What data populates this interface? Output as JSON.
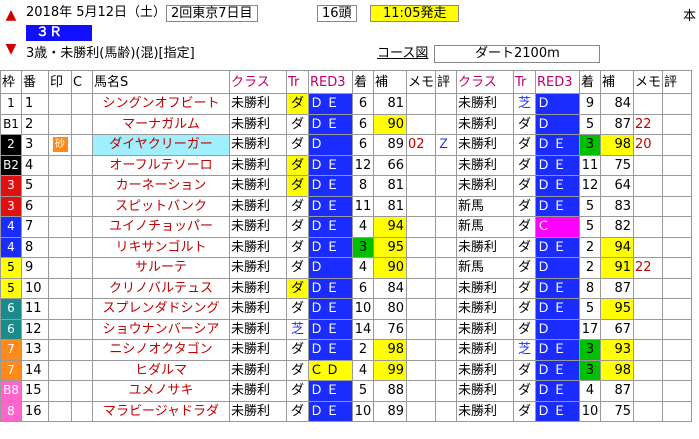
{
  "header": {
    "date": "2018年 5月12日（土）",
    "meeting": "2回東京7日目",
    "headcount": "16頭",
    "post_time": "11:05発走",
    "race_no": "３Ｒ",
    "conditions": "3歳・未勝利(馬齢)(混)[指定]",
    "course_label": "コース図",
    "course": "ダート2100m",
    "corner_text": "本"
  },
  "columns": {
    "waku": "枠",
    "ban": "番",
    "mark": "印",
    "c": "C",
    "name": "馬名S",
    "class": "クラス",
    "tr": "Tr",
    "rep": "RED3",
    "chaku": "着",
    "ho": "補",
    "memo": "メモ",
    "hyo": "評",
    "class2": "クラス",
    "tr2": "Tr",
    "rep2": "RED3",
    "chaku2": "着",
    "ho2": "補",
    "memo2": "メモ",
    "hyo2": "評"
  },
  "rows": [
    {
      "waku": "1",
      "wk": "w1",
      "ban": "1",
      "mark": "",
      "c": "",
      "name": "シングンオフビート",
      "cls": "未勝利",
      "tr": "ダ",
      "trc": "ylw",
      "r1": "Ｄ",
      "r2": "Ｅ",
      "rc": "blue",
      "ch": "6",
      "ho": "81",
      "hoc": "",
      "memo": "",
      "hyo": "",
      "cls2": "未勝利",
      "tr2": "芝",
      "tr2c": "trsh",
      "r21": "Ｄ",
      "r22": "",
      "r2c": "blue",
      "ch2": "9",
      "ch2c": "",
      "ho2": "84",
      "ho2c": "",
      "memo2": "",
      "hyo2": ""
    },
    {
      "waku": "B1",
      "wk": "w1",
      "ban": "2",
      "mark": "",
      "c": "",
      "name": "マーナガルム",
      "cls": "未勝利",
      "tr": "ダ",
      "trc": "",
      "r1": "Ｄ",
      "r2": "Ｅ",
      "rc": "blue",
      "ch": "6",
      "ho": "90",
      "hoc": "ylw",
      "memo": "",
      "hyo": "",
      "cls2": "未勝利",
      "tr2": "ダ",
      "tr2c": "",
      "r21": "Ｄ",
      "r22": "",
      "r2c": "blue",
      "ch2": "5",
      "ch2c": "",
      "ho2": "87",
      "ho2c": "",
      "memo2": "22",
      "hyo2": ""
    },
    {
      "waku": "2",
      "wk": "w2",
      "ban": "3",
      "mark": "砂",
      "c": "",
      "name": "ダイヤクリーガー",
      "cls": "未勝利",
      "tr": "ダ",
      "trc": "",
      "r1": "Ｄ",
      "r2": "",
      "rc": "blue",
      "ch": "6",
      "ho": "89",
      "hoc": "",
      "memo": "02",
      "hyo": "Ｚ",
      "cls2": "未勝利",
      "tr2": "ダ",
      "tr2c": "",
      "r21": "Ｄ",
      "r22": "Ｅ",
      "r2c": "blue",
      "ch2": "3",
      "ch2c": "grn",
      "ho2": "98",
      "ho2c": "ylw",
      "memo2": "20",
      "hyo2": ""
    },
    {
      "waku": "B2",
      "wk": "w2",
      "ban": "4",
      "mark": "",
      "c": "",
      "name": "オーフルテソーロ",
      "cls": "未勝利",
      "tr": "ダ",
      "trc": "ylw",
      "r1": "Ｄ",
      "r2": "Ｅ",
      "rc": "blue",
      "ch": "12",
      "ho": "66",
      "hoc": "",
      "memo": "",
      "hyo": "",
      "cls2": "未勝利",
      "tr2": "ダ",
      "tr2c": "",
      "r21": "Ｄ",
      "r22": "Ｅ",
      "r2c": "blue",
      "ch2": "11",
      "ch2c": "",
      "ho2": "75",
      "ho2c": "",
      "memo2": "",
      "hyo2": ""
    },
    {
      "waku": "3",
      "wk": "w3",
      "ban": "5",
      "mark": "",
      "c": "",
      "name": "カーネーション",
      "cls": "未勝利",
      "tr": "ダ",
      "trc": "ylw",
      "r1": "Ｄ",
      "r2": "Ｅ",
      "rc": "blue",
      "ch": "8",
      "ho": "81",
      "hoc": "",
      "memo": "",
      "hyo": "",
      "cls2": "未勝利",
      "tr2": "ダ",
      "tr2c": "",
      "r21": "Ｄ",
      "r22": "Ｅ",
      "r2c": "blue",
      "ch2": "12",
      "ch2c": "",
      "ho2": "64",
      "ho2c": "",
      "memo2": "",
      "hyo2": ""
    },
    {
      "waku": "3",
      "wk": "w3",
      "ban": "6",
      "mark": "",
      "c": "",
      "name": "スピットバンク",
      "cls": "未勝利",
      "tr": "ダ",
      "trc": "",
      "r1": "Ｄ",
      "r2": "Ｅ",
      "rc": "blue",
      "ch": "11",
      "ho": "81",
      "hoc": "",
      "memo": "",
      "hyo": "",
      "cls2": "新馬",
      "tr2": "ダ",
      "tr2c": "",
      "r21": "Ｄ",
      "r22": "Ｅ",
      "r2c": "blue",
      "ch2": "5",
      "ch2c": "",
      "ho2": "83",
      "ho2c": "",
      "memo2": "",
      "hyo2": ""
    },
    {
      "waku": "4",
      "wk": "w4",
      "ban": "7",
      "mark": "",
      "c": "",
      "name": "ユイノチョッパー",
      "cls": "未勝利",
      "tr": "ダ",
      "trc": "",
      "r1": "Ｄ",
      "r2": "Ｅ",
      "rc": "blue",
      "ch": "4",
      "ho": "94",
      "hoc": "ylw",
      "memo": "",
      "hyo": "",
      "cls2": "新馬",
      "tr2": "ダ",
      "tr2c": "",
      "r21": "Ｃ",
      "r22": "",
      "r2c": "mag",
      "ch2": "5",
      "ch2c": "",
      "ho2": "82",
      "ho2c": "",
      "memo2": "",
      "hyo2": ""
    },
    {
      "waku": "4",
      "wk": "w4",
      "ban": "8",
      "mark": "",
      "c": "",
      "name": "リキサンゴルト",
      "cls": "未勝利",
      "tr": "ダ",
      "trc": "",
      "r1": "Ｄ",
      "r2": "Ｅ",
      "rc": "blue",
      "ch": "3",
      "chc": "grn",
      "ho": "95",
      "hoc": "ylw",
      "memo": "",
      "hyo": "",
      "cls2": "未勝利",
      "tr2": "ダ",
      "tr2c": "",
      "r21": "Ｄ",
      "r22": "Ｅ",
      "r2c": "blue",
      "ch2": "2",
      "ch2c": "",
      "ho2": "94",
      "ho2c": "ylw",
      "memo2": "",
      "hyo2": ""
    },
    {
      "waku": "5",
      "wk": "w5",
      "ban": "9",
      "mark": "",
      "c": "",
      "name": "サルーテ",
      "cls": "未勝利",
      "tr": "ダ",
      "trc": "",
      "r1": "Ｄ",
      "r2": "",
      "rc": "blue",
      "ch": "4",
      "ho": "90",
      "hoc": "ylw",
      "memo": "",
      "hyo": "",
      "cls2": "新馬",
      "tr2": "ダ",
      "tr2c": "",
      "r21": "Ｄ",
      "r22": "",
      "r2c": "blue",
      "ch2": "2",
      "ch2c": "",
      "ho2": "91",
      "ho2c": "ylw",
      "memo2": "22",
      "hyo2": ""
    },
    {
      "waku": "5",
      "wk": "w5",
      "ban": "10",
      "mark": "",
      "c": "",
      "name": "クリノバルテュス",
      "cls": "未勝利",
      "tr": "ダ",
      "trc": "ylw",
      "r1": "Ｄ",
      "r2": "Ｅ",
      "rc": "blue",
      "ch": "6",
      "ho": "84",
      "hoc": "",
      "memo": "",
      "hyo": "",
      "cls2": "未勝利",
      "tr2": "ダ",
      "tr2c": "",
      "r21": "Ｄ",
      "r22": "Ｅ",
      "r2c": "blue",
      "ch2": "8",
      "ch2c": "",
      "ho2": "87",
      "ho2c": "",
      "memo2": "",
      "hyo2": ""
    },
    {
      "waku": "6",
      "wk": "w6",
      "ban": "11",
      "mark": "",
      "c": "",
      "name": "スプレンダドシング",
      "cls": "未勝利",
      "tr": "ダ",
      "trc": "",
      "r1": "Ｄ",
      "r2": "Ｅ",
      "rc": "blue",
      "ch": "10",
      "ho": "80",
      "hoc": "",
      "memo": "",
      "hyo": "",
      "cls2": "未勝利",
      "tr2": "ダ",
      "tr2c": "",
      "r21": "Ｄ",
      "r22": "Ｅ",
      "r2c": "blue",
      "ch2": "5",
      "ch2c": "",
      "ho2": "95",
      "ho2c": "ylw",
      "memo2": "",
      "hyo2": ""
    },
    {
      "waku": "6",
      "wk": "w6",
      "ban": "12",
      "mark": "",
      "c": "",
      "name": "ショウナンバーシア",
      "cls": "未勝利",
      "tr": "芝",
      "trc": "trsh",
      "r1": "Ｄ",
      "r2": "Ｅ",
      "rc": "blue",
      "ch": "14",
      "ho": "76",
      "hoc": "",
      "memo": "",
      "hyo": "",
      "cls2": "未勝利",
      "tr2": "ダ",
      "tr2c": "",
      "r21": "Ｄ",
      "r22": "",
      "r2c": "blue",
      "ch2": "17",
      "ch2c": "",
      "ho2": "67",
      "ho2c": "",
      "memo2": "",
      "hyo2": ""
    },
    {
      "waku": "7",
      "wk": "w7",
      "ban": "13",
      "mark": "",
      "c": "",
      "name": "ニシノオクタゴン",
      "cls": "未勝利",
      "tr": "ダ",
      "trc": "",
      "r1": "Ｄ",
      "r2": "Ｅ",
      "rc": "blue",
      "ch": "2",
      "ho": "98",
      "hoc": "ylw",
      "memo": "",
      "hyo": "",
      "cls2": "未勝利",
      "tr2": "芝",
      "tr2c": "trsh",
      "r21": "Ｄ",
      "r22": "Ｅ",
      "r2c": "blue",
      "ch2": "3",
      "ch2c": "grn",
      "ho2": "93",
      "ho2c": "ylw",
      "memo2": "",
      "hyo2": ""
    },
    {
      "waku": "7",
      "wk": "w7",
      "ban": "14",
      "mark": "",
      "c": "",
      "name": "ヒダルマ",
      "cls": "未勝利",
      "tr": "ダ",
      "trc": "",
      "r1": "Ｃ",
      "r2": "Ｄ",
      "rc": "ylw",
      "ch": "4",
      "ho": "99",
      "hoc": "ylw",
      "memo": "",
      "hyo": "",
      "cls2": "未勝利",
      "tr2": "ダ",
      "tr2c": "",
      "r21": "Ｄ",
      "r22": "Ｅ",
      "r2c": "blue",
      "ch2": "3",
      "ch2c": "grn",
      "ho2": "98",
      "ho2c": "ylw",
      "memo2": "",
      "hyo2": ""
    },
    {
      "waku": "B8",
      "wk": "w8",
      "ban": "15",
      "mark": "",
      "c": "",
      "name": "ユメノサキ",
      "cls": "未勝利",
      "tr": "ダ",
      "trc": "",
      "r1": "Ｄ",
      "r2": "Ｅ",
      "rc": "blue",
      "ch": "5",
      "ho": "88",
      "hoc": "",
      "memo": "",
      "hyo": "",
      "cls2": "未勝利",
      "tr2": "ダ",
      "tr2c": "",
      "r21": "Ｄ",
      "r22": "Ｅ",
      "r2c": "blue",
      "ch2": "4",
      "ch2c": "",
      "ho2": "87",
      "ho2c": "",
      "memo2": "",
      "hyo2": ""
    },
    {
      "waku": "8",
      "wk": "w8",
      "ban": "16",
      "mark": "",
      "c": "",
      "name": "マラビージャドラダ",
      "cls": "未勝利",
      "tr": "ダ",
      "trc": "",
      "r1": "Ｄ",
      "r2": "Ｅ",
      "rc": "blue",
      "ch": "10",
      "ho": "89",
      "hoc": "",
      "memo": "",
      "hyo": "",
      "cls2": "未勝利",
      "tr2": "ダ",
      "tr2c": "",
      "r21": "Ｄ",
      "r22": "Ｅ",
      "r2c": "blue",
      "ch2": "10",
      "ch2c": "",
      "ho2": "75",
      "ho2c": "",
      "memo2": "",
      "hyo2": ""
    }
  ],
  "colors": {
    "accent": "#1a2cff",
    "highlight": "#ffff00",
    "selected": "#9fefff",
    "header_pink": "#c0006a"
  }
}
